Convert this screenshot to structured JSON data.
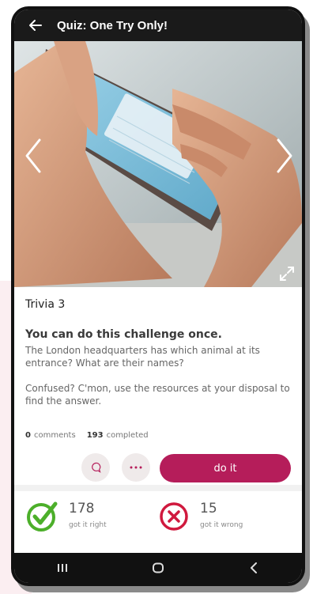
{
  "header": {
    "title": "Quiz: One Try Only!",
    "back_icon": "arrow-left-icon"
  },
  "hero": {
    "nav_left_icon": "chevron-left-icon",
    "nav_right_icon": "chevron-right-icon",
    "expand_icon": "expand-icon"
  },
  "challenge": {
    "category": "Trivia 3",
    "headline": "You can do this challenge once.",
    "question": "The London headquarters has which animal at its entrance? What are their names?",
    "hint": "Confused? C'mon, use the resources at your disposal to find the answer.",
    "comments_count": "0",
    "comments_label": "comments",
    "completed_count": "193",
    "completed_label": "completed",
    "action_label": "do it"
  },
  "results": {
    "right_count": "178",
    "right_label": "got it right",
    "wrong_count": "15",
    "wrong_label": "got it wrong"
  },
  "colors": {
    "accent": "#b51d5a",
    "success": "#4caf2a",
    "error": "#d0193e"
  }
}
